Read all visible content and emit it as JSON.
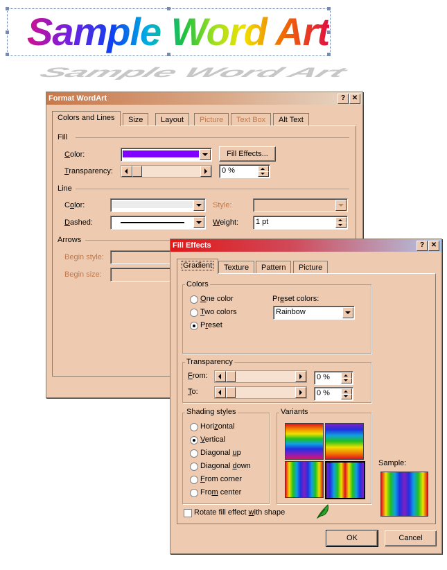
{
  "wordart": {
    "text": "Sample Word Art"
  },
  "format_dialog": {
    "title": "Format WordArt",
    "help_btn": "?",
    "close_btn": "✕",
    "tabs": [
      "Colors and Lines",
      "Size",
      "Layout",
      "Picture",
      "Text Box",
      "Alt Text"
    ],
    "fill_section": "Fill",
    "color_label": "Color:",
    "fill_color": "#8000ff",
    "fill_effects_btn": "Fill Effects...",
    "transparency_label": "Transparency:",
    "transparency_value": "0 %",
    "line_section": "Line",
    "line_color_label": "Color:",
    "style_label": "Style:",
    "dashed_label": "Dashed:",
    "weight_label": "Weight:",
    "weight_value": "1 pt",
    "arrows_section": "Arrows",
    "begin_style_label": "Begin style:",
    "begin_size_label": "Begin size:"
  },
  "fill_dialog": {
    "title": "Fill Effects",
    "help_btn": "?",
    "close_btn": "✕",
    "tabs": [
      "Gradient",
      "Texture",
      "Pattern",
      "Picture"
    ],
    "colors_group": "Colors",
    "color_options": [
      "One color",
      "Two colors",
      "Preset"
    ],
    "selected_color_option": "Preset",
    "preset_colors_label": "Preset colors:",
    "preset_value": "Rainbow",
    "transparency_group": "Transparency",
    "from_label": "From:",
    "from_value": "0 %",
    "to_label": "To:",
    "to_value": "0 %",
    "shading_group": "Shading styles",
    "shading_options": [
      "Horizontal",
      "Vertical",
      "Diagonal up",
      "Diagonal down",
      "From corner",
      "From center"
    ],
    "selected_shading": "Vertical",
    "variants_group": "Variants",
    "sample_label": "Sample:",
    "rotate_label": "Rotate fill effect with shape",
    "rotate_checked": false,
    "ok_btn": "OK",
    "cancel_btn": "Cancel"
  }
}
